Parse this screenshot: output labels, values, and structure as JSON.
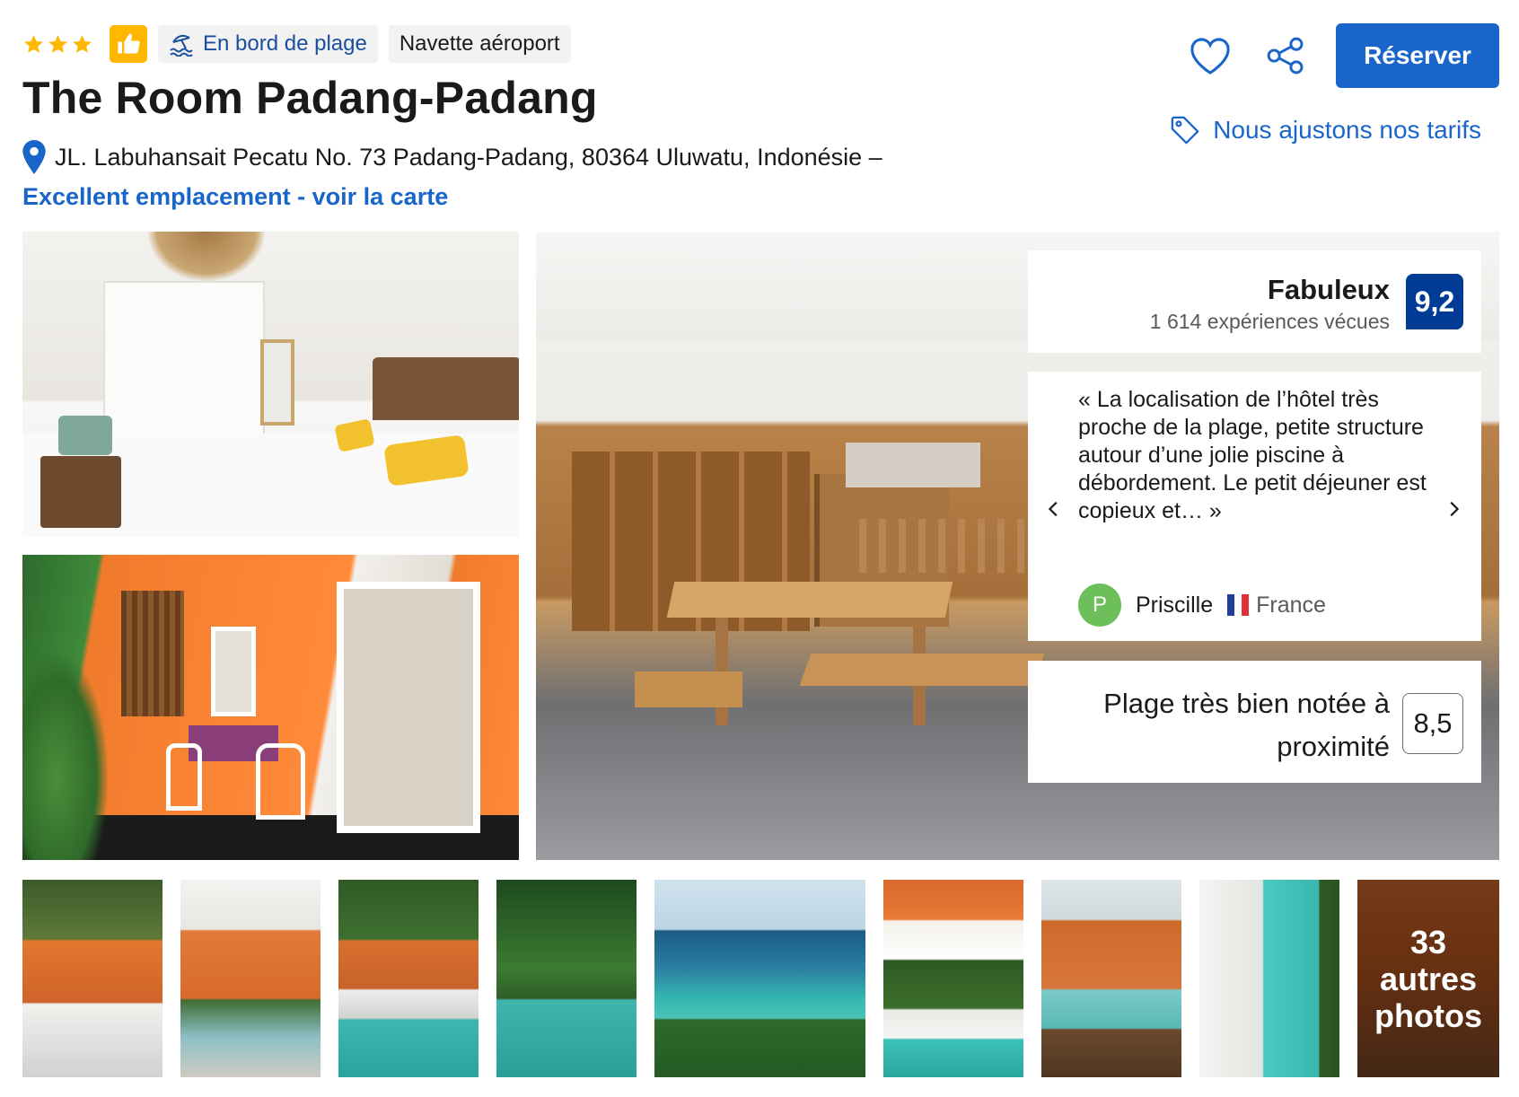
{
  "header": {
    "star_count": 3,
    "tags": [
      {
        "label": "En bord de plage",
        "icon": "beach-umbrella-icon"
      },
      {
        "label": "Navette aéroport"
      }
    ],
    "title": "The Room Padang-Padang",
    "address": "JL. Labuhansait Pecatu No. 73 Padang-Padang, 80364 Uluwatu, Indonésie –",
    "location_link": "Excellent emplacement - voir la carte",
    "reserve_label": "Réserver",
    "price_note": "Nous ajustons nos tarifs"
  },
  "rating": {
    "label": "Fabuleux",
    "count": "1 614 expériences vécues",
    "score": "9,2"
  },
  "review": {
    "text": "« La localisation de l’hôtel très proche de la plage, petite structure autour d’une jolie piscine à débordement. Le petit déjeuner est copieux et… »",
    "avatar_initial": "P",
    "name": "Priscille",
    "country": "France"
  },
  "beach": {
    "label": "Plage très bien notée à proximité",
    "score": "8,5"
  },
  "more_photos": "33 autres photos",
  "colors": {
    "accent": "#1a65c9",
    "score_bg": "#003b95",
    "star": "#ffb700",
    "avatar": "#6dbf5b"
  }
}
